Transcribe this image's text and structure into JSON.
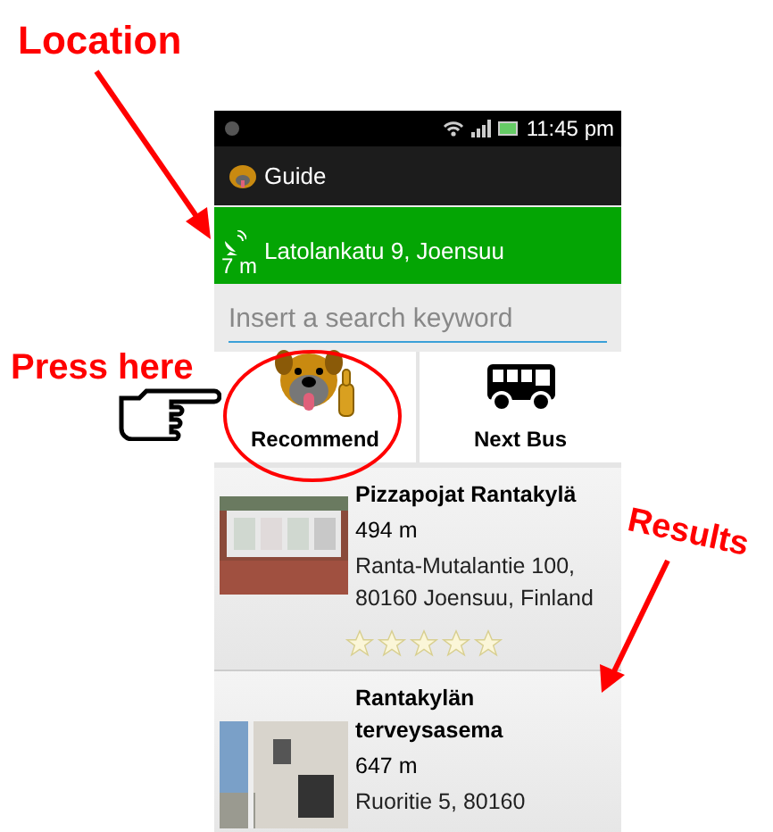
{
  "annotations": [
    {
      "kind": "location",
      "text": "Location"
    },
    {
      "kind": "press",
      "text": "Press here"
    },
    {
      "kind": "results",
      "text": "Results"
    }
  ],
  "status_bar": {
    "time": "11:45 pm"
  },
  "app_bar": {
    "title": "Guide"
  },
  "location_bar": {
    "address": "Latolankatu 9, Joensuu",
    "accuracy": "7 m"
  },
  "search": {
    "placeholder": "Insert a search keyword"
  },
  "actions": [
    {
      "label": "Recommend",
      "kind": "recommend"
    },
    {
      "label": "Next Bus",
      "kind": "bus"
    }
  ],
  "results": [
    {
      "name": "Pizzapojat Rantakylä",
      "distance": "494 m",
      "address": "Ranta-Mutalantie 100, 80160 Joensuu, Finland",
      "stars": 0
    },
    {
      "name": "Rantakylän terveysasema",
      "distance": "647 m",
      "address": "Ruoritie 5, 80160"
    }
  ]
}
